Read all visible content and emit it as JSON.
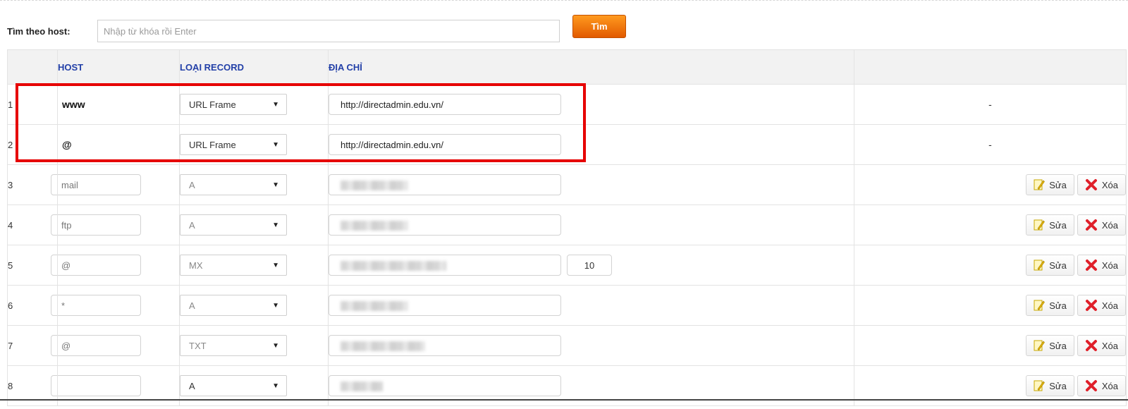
{
  "search": {
    "label": "Tìm theo host:",
    "placeholder": "Nhập từ khóa rồi Enter",
    "value": "",
    "button_label": "Tìm"
  },
  "table": {
    "headers": {
      "num": "",
      "host": "HOST",
      "type": "LOẠI RECORD",
      "address": "ĐỊA CHỈ",
      "actions": ""
    },
    "rows": [
      {
        "num": "1",
        "host": "www",
        "type": "URL Frame",
        "address": "http://directadmin.edu.vn/",
        "priority": "",
        "actions": "-"
      },
      {
        "num": "2",
        "host": "@",
        "type": "URL Frame",
        "address": "http://directadmin.edu.vn/",
        "priority": "",
        "actions": "-"
      },
      {
        "num": "3",
        "host": "mail",
        "type": "A",
        "address": "",
        "priority": "",
        "actions": ""
      },
      {
        "num": "4",
        "host": "ftp",
        "type": "A",
        "address": "",
        "priority": "",
        "actions": ""
      },
      {
        "num": "5",
        "host": "@",
        "type": "MX",
        "address": "",
        "priority": "10",
        "actions": ""
      },
      {
        "num": "6",
        "host": "*",
        "type": "A",
        "address": "",
        "priority": "",
        "actions": ""
      },
      {
        "num": "7",
        "host": "@",
        "type": "TXT",
        "address": "",
        "priority": "",
        "actions": ""
      },
      {
        "num": "8",
        "host": "",
        "type": "A",
        "address": "",
        "priority": "",
        "actions": ""
      }
    ],
    "edit_label": "Sửa",
    "delete_label": "Xóa"
  },
  "colors": {
    "accent": "#ff8c00",
    "header_text": "#2340a8",
    "highlight": "#e60000"
  }
}
